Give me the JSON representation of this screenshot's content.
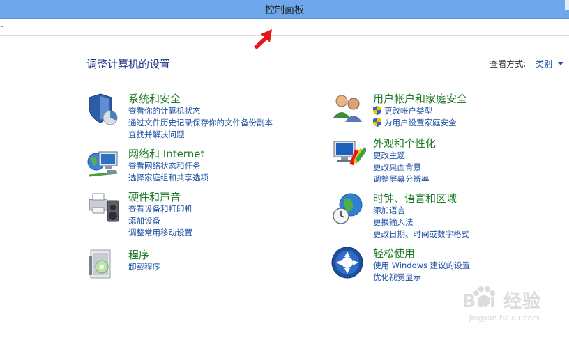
{
  "window": {
    "title": "控制面板"
  },
  "page": {
    "title": "调整计算机的设置",
    "view_by_label": "查看方式:",
    "view_by_value": "类别"
  },
  "categories": [
    {
      "name": "system-security",
      "icon": "shield-pie-icon",
      "title": "系统和安全",
      "links": [
        "查看你的计算机状态",
        "通过文件历史记录保存你的文件备份副本",
        "查找并解决问题"
      ]
    },
    {
      "name": "network-internet",
      "icon": "network-globe-icon",
      "title": "网络和 Internet",
      "links": [
        "查看网络状态和任务",
        "选择家庭组和共享选项"
      ]
    },
    {
      "name": "hardware-sound",
      "icon": "printer-speaker-icon",
      "title": "硬件和声音",
      "links": [
        "查看设备和打印机",
        "添加设备",
        "调整常用移动设置"
      ]
    },
    {
      "name": "programs",
      "icon": "program-box-icon",
      "title": "程序",
      "links": [
        "卸载程序"
      ]
    },
    {
      "name": "user-accounts",
      "icon": "users-icon",
      "title": "用户帐户和家庭安全",
      "links": [
        "更改帐户类型",
        "为用户设置家庭安全"
      ]
    },
    {
      "name": "appearance",
      "icon": "monitor-palette-icon",
      "title": "外观和个性化",
      "links": [
        "更改主题",
        "更改桌面背景",
        "调整屏幕分辨率"
      ]
    },
    {
      "name": "clock-region",
      "icon": "clock-globe-icon",
      "title": "时钟、语言和区域",
      "links": [
        "添加语言",
        "更换输入法",
        "更改日期、时间或数字格式"
      ]
    },
    {
      "name": "ease-of-access",
      "icon": "ease-of-access-icon",
      "title": "轻松使用",
      "links": [
        "使用 Windows 建议的设置",
        "优化视觉显示"
      ]
    }
  ],
  "watermark": {
    "text": "Bai 经验",
    "url": "jingyan.baidu.com"
  },
  "colors": {
    "titlebar": "#6fa7ec",
    "heading_green": "#1e7a25",
    "link_blue": "#1e50a2",
    "title_navy": "#1e3287",
    "arrow_red": "#e8141a"
  }
}
